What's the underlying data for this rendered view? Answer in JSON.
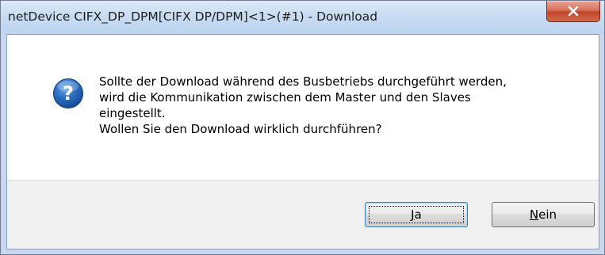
{
  "window": {
    "title": "netDevice CIFX_DP_DPM[CIFX DP/DPM]<1>(#1) - Download"
  },
  "titlebar": {
    "close_icon": "close-x-icon"
  },
  "dialog": {
    "icon": "question-icon",
    "message_lines": [
      "Sollte der Download während des Busbetriebs durchgeführt werden,",
      "wird die Kommunikation zwischen dem Master und den Slaves",
      "eingestellt.",
      "Wollen Sie den Download wirklich durchführen?"
    ]
  },
  "buttons": {
    "yes": {
      "mnemonic": "J",
      "rest": "a"
    },
    "no": {
      "mnemonic": "N",
      "rest": "ein"
    }
  },
  "colors": {
    "titlebar": "#c9dcf2",
    "close_button": "#c14528",
    "icon_blue": "#1f5fa8",
    "button_bar": "#f0f0f0"
  }
}
